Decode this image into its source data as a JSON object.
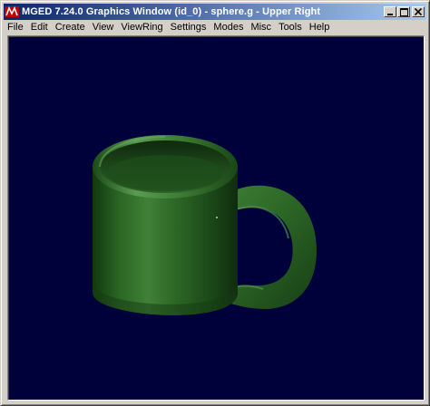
{
  "window": {
    "title": "MGED 7.24.0 Graphics Window (id_0) - sphere.g - Upper Right",
    "icon": "mged-app-icon",
    "controls": [
      "minimize-icon",
      "maximize-icon",
      "close-icon"
    ]
  },
  "menu": {
    "items": [
      "File",
      "Edit",
      "Create",
      "View",
      "ViewRing",
      "Settings",
      "Modes",
      "Misc",
      "Tools",
      "Help"
    ]
  },
  "viewport": {
    "background_color": "#00003a",
    "model": "coffee-mug",
    "model_color": "#2f6a2a"
  },
  "colors": {
    "titlebar_start": "#0a246a",
    "titlebar_end": "#a6caf0",
    "chrome": "#d4d0c8"
  }
}
